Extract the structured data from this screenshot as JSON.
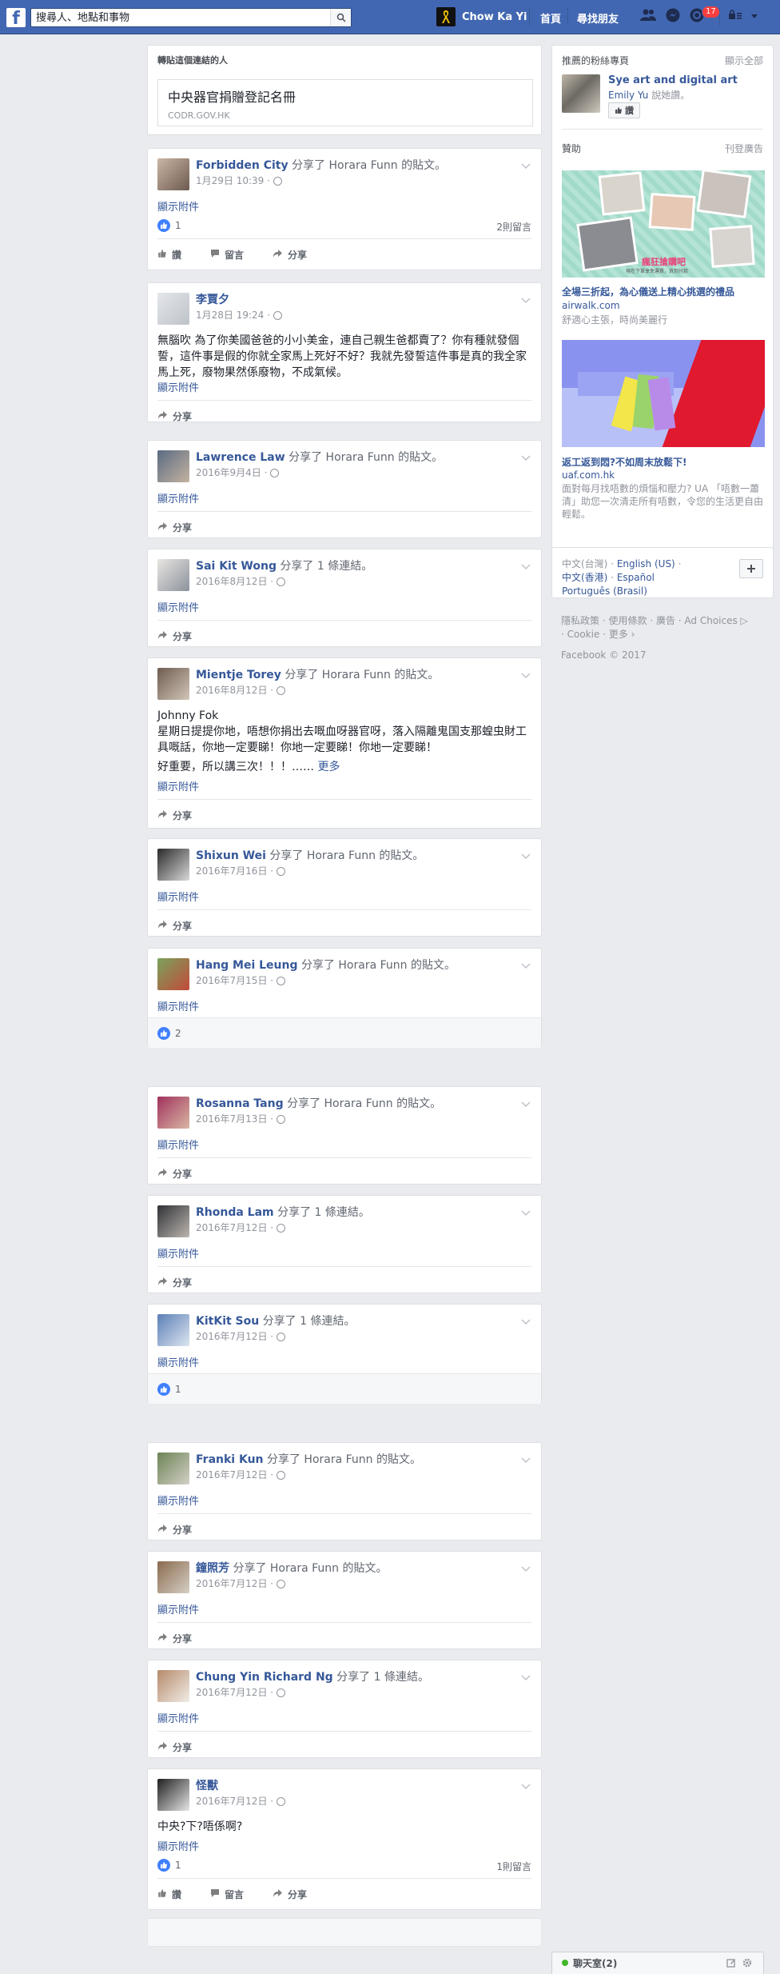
{
  "topbar": {
    "search_placeholder": "搜尋人、地點和事物",
    "user_name": "Chow Ka Yi",
    "nav_home": "首頁",
    "nav_friends": "尋找朋友",
    "notification_count": "17"
  },
  "share_card": {
    "title": "轉貼這個連結的人",
    "link_title": "中央器官捐贈登記名冊",
    "link_domain": "CODR.GOV.HK"
  },
  "post_actions": {
    "like": "讚",
    "comment": "留言",
    "share": "分享"
  },
  "posts": [
    {
      "author": "Forbidden City",
      "shared": "分享了",
      "target": "Horara Funn",
      "of": "的",
      "type": "貼文。",
      "date": "1月29日 10:39 · ",
      "attach": "顯示附件",
      "likes": "1",
      "comments": "2則留言"
    },
    {
      "author": "李賈夕",
      "date": "1月28日 19:24 · ",
      "body": "無腦吹 為了你美國爸爸的小小美金，連自己親生爸都賣了？你有種就發個誓，這件事是假的你就全家馬上死好不好？我就先發誓這件事是真的我全家馬上死，廢物果然係廢物，不成氣候。",
      "attach": "顯示附件"
    },
    {
      "author": "Lawrence Law",
      "shared": "分享了",
      "target": "Horara Funn",
      "of": "的",
      "type": "貼文。",
      "date": "2016年9月4日 · ",
      "attach": "顯示附件"
    },
    {
      "author": "Sai Kit Wong",
      "shared": "分享了 1 條",
      "type": "連結。",
      "date": "2016年8月12日 · ",
      "attach": "顯示附件"
    },
    {
      "author": "Mientje Torey",
      "shared": "分享了",
      "target": "Horara Funn",
      "of": "的",
      "type": "貼文。",
      "date": "2016年8月12日 · ",
      "body1": "Johnny Fok",
      "body2": "星期日提提你地，唔想你捐出去嘅血呀器官呀，落入隔離鬼国支那蝗虫財工具嘅話，你地一定要睇！你地一定要睇！你地一定要睇！",
      "body3": "好重要，所以講三次！！！……",
      "more": "更多",
      "attach": "顯示附件"
    },
    {
      "author": "Shixun Wei",
      "shared": "分享了",
      "target": "Horara Funn",
      "of": "的",
      "type": "貼文。",
      "date": "2016年7月16日 · ",
      "attach": "顯示附件"
    },
    {
      "author": "Hang Mei Leung",
      "shared": "分享了",
      "target": "Horara Funn",
      "of": "的",
      "type": "貼文。",
      "date": "2016年7月15日 · ",
      "attach": "顯示附件",
      "likes": "2"
    },
    {
      "author": "Rosanna Tang",
      "shared": "分享了",
      "target": "Horara Funn",
      "of": "的",
      "type": "貼文。",
      "date": "2016年7月13日 · ",
      "attach": "顯示附件"
    },
    {
      "author": "Rhonda Lam",
      "shared": "分享了 1 條",
      "type": "連結。",
      "date": "2016年7月12日 · ",
      "attach": "顯示附件"
    },
    {
      "author": "KitKit Sou",
      "shared": "分享了 1 條",
      "type": "連結。",
      "date": "2016年7月12日 · ",
      "attach": "顯示附件",
      "likes": "1"
    },
    {
      "author": "Franki Kun",
      "shared": "分享了",
      "target": "Horara Funn",
      "of": "的",
      "type": "貼文。",
      "date": "2016年7月12日 · ",
      "attach": "顯示附件"
    },
    {
      "author": "鐘照芳",
      "shared": "分享了",
      "target": "Horara Funn",
      "of": "的",
      "type": "貼文。",
      "date": "2016年7月12日 · ",
      "attach": "顯示附件"
    },
    {
      "author": "Chung Yin Richard Ng",
      "shared": "分享了 1 條",
      "type": "連結。",
      "date": "2016年7月12日 · ",
      "attach": "顯示附件"
    },
    {
      "author": "怪獸",
      "date": "2016年7月12日 · ",
      "body": "中央?下?唔係啊?",
      "attach": "顯示附件",
      "likes": "1",
      "comments": "1則留言"
    }
  ],
  "sidebar": {
    "pages_title": "推薦的粉絲專頁",
    "see_all": "顯示全部",
    "page_name": "Sye art and digital art",
    "page_friend": "Emily Yu",
    "page_says": " 說她讚。",
    "like_btn": "讚",
    "sponsored": "贊助",
    "create_ad": "刊登廣告",
    "ad1_banner": "瘋狂搶購吧",
    "ad1_banner_sub": "現在下單享免運費，貨到付款",
    "ad1_title": "全場三折起，為心儀送上精心挑選的禮品",
    "ad1_domain": "airwalk.com",
    "ad1_desc": "舒適心主張，時尚美麗行",
    "ad2_title": "返工返到悶?不如周末放鬆下!",
    "ad2_domain": "uaf.com.hk",
    "ad2_desc": "面對每月找唔數的煩惱和壓力? UA 「唔數一蕭清」助您一次清走所有唔數，令您的生活更自由輕鬆。",
    "lang_zh_tw": "中文(台灣)",
    "lang_en": "English (US)",
    "lang_zh_hk": "中文(香港)",
    "lang_es": "Español",
    "lang_pt": "Português (Brasil)",
    "footer_links": [
      "隱私政策",
      "使用條款",
      "廣告",
      "Ad Choices",
      "Cookie",
      "更多"
    ],
    "copyright": "Facebook © 2017"
  },
  "chat": {
    "label": "聊天室(2)"
  },
  "colors": {
    "brand": "#4267b2",
    "link": "#365899",
    "background": "#e9ebee"
  },
  "icons": [
    "facebook-logo-icon",
    "search-icon",
    "friends-icon",
    "messenger-icon",
    "globe-icon",
    "chevron-down-icon",
    "like-icon",
    "comment-icon",
    "share-icon",
    "plus-icon",
    "compose-icon",
    "gear-icon"
  ]
}
